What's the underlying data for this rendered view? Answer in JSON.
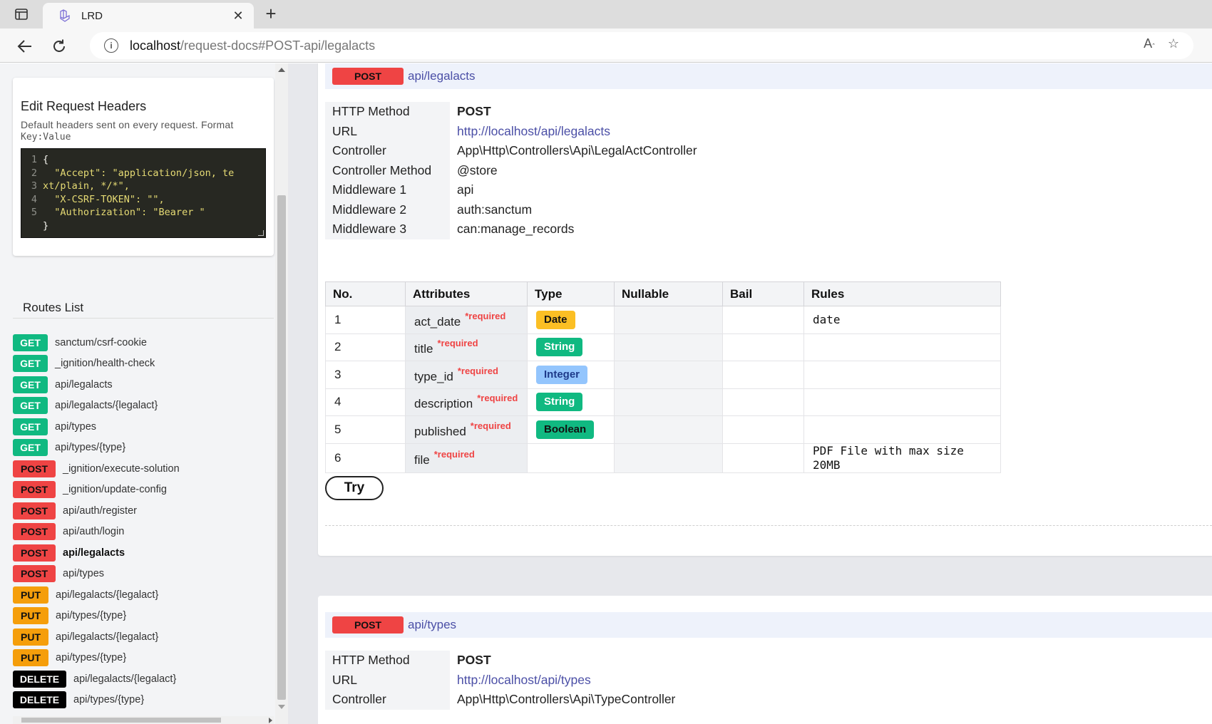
{
  "browser": {
    "tab_title": "LRD",
    "url_host": "localhost",
    "url_path": "/request-docs#POST-api/legalacts"
  },
  "sidebar": {
    "headers_title": "Edit Request Headers",
    "headers_hint": "Default headers sent on every request. Format",
    "headers_hint_code": "Key:Value",
    "editor_lines": [
      {
        "n": "1",
        "text": "{"
      },
      {
        "n": "2",
        "text": "  \"Accept\": \"application/json, te"
      },
      {
        "n": "3",
        "text": "xt/plain, */*\","
      },
      {
        "n": "4",
        "text": "  \"X-CSRF-TOKEN\": \"\","
      },
      {
        "n": "5",
        "text": "  \"Authorization\": \"Bearer \""
      },
      {
        "n": "",
        "text": "}"
      }
    ],
    "routes_title": "Routes List",
    "routes": [
      {
        "method": "GET",
        "path": "sanctum/csrf-cookie"
      },
      {
        "method": "GET",
        "path": "_ignition/health-check"
      },
      {
        "method": "GET",
        "path": "api/legalacts"
      },
      {
        "method": "GET",
        "path": "api/legalacts/{legalact}"
      },
      {
        "method": "GET",
        "path": "api/types"
      },
      {
        "method": "GET",
        "path": "api/types/{type}"
      },
      {
        "method": "POST",
        "path": "_ignition/execute-solution"
      },
      {
        "method": "POST",
        "path": "_ignition/update-config"
      },
      {
        "method": "POST",
        "path": "api/auth/register"
      },
      {
        "method": "POST",
        "path": "api/auth/login"
      },
      {
        "method": "POST",
        "path": "api/legalacts"
      },
      {
        "method": "POST",
        "path": "api/types"
      },
      {
        "method": "PUT",
        "path": "api/legalacts/{legalact}"
      },
      {
        "method": "PUT",
        "path": "api/types/{type}"
      },
      {
        "method": "PUT",
        "path": "api/legalacts/{legalact}"
      },
      {
        "method": "PUT",
        "path": "api/types/{type}"
      },
      {
        "method": "DELETE",
        "path": "api/legalacts/{legalact}"
      },
      {
        "method": "DELETE",
        "path": "api/types/{type}"
      }
    ]
  },
  "endpoint1": {
    "method": "POST",
    "path": "api/legalacts",
    "info": [
      {
        "key": "HTTP Method",
        "value": "POST"
      },
      {
        "key": "URL",
        "value": "http://localhost/api/legalacts"
      },
      {
        "key": "Controller",
        "value": "App\\Http\\Controllers\\Api\\LegalActController"
      },
      {
        "key": "Controller Method",
        "value": "@store"
      },
      {
        "key": "Middleware 1",
        "value": "api"
      },
      {
        "key": "Middleware 2",
        "value": "auth:sanctum"
      },
      {
        "key": "Middleware 3",
        "value": "can:manage_records"
      }
    ],
    "columns": [
      "No.",
      "Attributes",
      "Type",
      "Nullable",
      "Bail",
      "Rules"
    ],
    "rows": [
      {
        "no": "1",
        "attr": "act_date",
        "req": "*required",
        "type": "Date",
        "rule": "date"
      },
      {
        "no": "2",
        "attr": "title",
        "req": "*required",
        "type": "String",
        "rule": ""
      },
      {
        "no": "3",
        "attr": "type_id",
        "req": "*required",
        "type": "Integer",
        "rule": ""
      },
      {
        "no": "4",
        "attr": "description",
        "req": "*required",
        "type": "String",
        "rule": ""
      },
      {
        "no": "5",
        "attr": "published",
        "req": "*required",
        "type": "Boolean",
        "rule": ""
      },
      {
        "no": "6",
        "attr": "file",
        "req": "*required",
        "type": "",
        "rule": "PDF File with max size 20MB"
      }
    ],
    "try_label": "Try"
  },
  "endpoint2": {
    "method": "POST",
    "path": "api/types",
    "info": [
      {
        "key": "HTTP Method",
        "value": "POST"
      },
      {
        "key": "URL",
        "value": "http://localhost/api/types"
      },
      {
        "key": "Controller",
        "value": "App\\Http\\Controllers\\Api\\TypeController"
      }
    ]
  },
  "colors": {
    "get": "#10b981",
    "post": "#ef4444",
    "put": "#f59e0b",
    "delete": "#000000",
    "link": "#4b4fa6"
  }
}
